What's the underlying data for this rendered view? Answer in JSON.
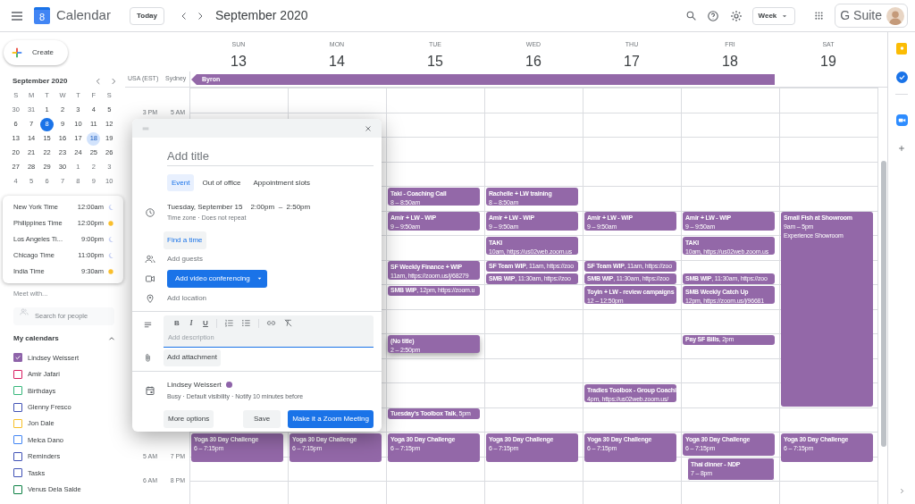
{
  "app": {
    "title": "Calendar",
    "logo_day": "8",
    "create_button": "Create"
  },
  "toolbar": {
    "today_button": "Today",
    "period": "September 2020",
    "view_dropdown": "Week",
    "suite_label": "G Suite"
  },
  "mini_calendar": {
    "title": "September 2020",
    "weekdays": [
      "S",
      "M",
      "T",
      "W",
      "T",
      "F",
      "S"
    ],
    "days": [
      {
        "d": "30",
        "kind": "outside"
      },
      {
        "d": "31",
        "kind": "outside"
      },
      {
        "d": "1",
        "kind": "normal"
      },
      {
        "d": "2",
        "kind": "normal"
      },
      {
        "d": "3",
        "kind": "normal"
      },
      {
        "d": "4",
        "kind": "normal"
      },
      {
        "d": "5",
        "kind": "normal"
      },
      {
        "d": "6",
        "kind": "normal"
      },
      {
        "d": "7",
        "kind": "normal"
      },
      {
        "d": "8",
        "kind": "today"
      },
      {
        "d": "9",
        "kind": "normal"
      },
      {
        "d": "10",
        "kind": "normal"
      },
      {
        "d": "11",
        "kind": "normal"
      },
      {
        "d": "12",
        "kind": "normal"
      },
      {
        "d": "13",
        "kind": "normal"
      },
      {
        "d": "14",
        "kind": "normal"
      },
      {
        "d": "15",
        "kind": "normal"
      },
      {
        "d": "16",
        "kind": "normal"
      },
      {
        "d": "17",
        "kind": "normal"
      },
      {
        "d": "18",
        "kind": "selected"
      },
      {
        "d": "19",
        "kind": "normal"
      },
      {
        "d": "20",
        "kind": "normal"
      },
      {
        "d": "21",
        "kind": "normal"
      },
      {
        "d": "22",
        "kind": "normal"
      },
      {
        "d": "23",
        "kind": "normal"
      },
      {
        "d": "24",
        "kind": "normal"
      },
      {
        "d": "25",
        "kind": "normal"
      },
      {
        "d": "26",
        "kind": "normal"
      },
      {
        "d": "27",
        "kind": "normal"
      },
      {
        "d": "28",
        "kind": "normal"
      },
      {
        "d": "29",
        "kind": "normal"
      },
      {
        "d": "30",
        "kind": "normal"
      },
      {
        "d": "1",
        "kind": "outside"
      },
      {
        "d": "2",
        "kind": "outside"
      },
      {
        "d": "3",
        "kind": "outside"
      },
      {
        "d": "4",
        "kind": "outside"
      },
      {
        "d": "5",
        "kind": "outside"
      },
      {
        "d": "6",
        "kind": "outside"
      },
      {
        "d": "7",
        "kind": "outside"
      },
      {
        "d": "8",
        "kind": "outside"
      },
      {
        "d": "9",
        "kind": "outside"
      },
      {
        "d": "10",
        "kind": "outside"
      }
    ]
  },
  "world_clock": [
    {
      "city": "New York Time",
      "time": "12:00am",
      "daytime": false
    },
    {
      "city": "Philippines Time",
      "time": "12:00pm",
      "daytime": true
    },
    {
      "city": "Los Angeles Ti...",
      "time": "9:00pm",
      "daytime": false
    },
    {
      "city": "Chicago Time",
      "time": "11:00pm",
      "daytime": false
    },
    {
      "city": "India Time",
      "time": "9:30am",
      "daytime": true
    }
  ],
  "meet_with": {
    "label": "Meet with...",
    "placeholder": "Search for people"
  },
  "my_calendars": {
    "title": "My calendars",
    "expanded": true,
    "items": [
      {
        "name": "Lindsey Weissert",
        "color": "#8e63a9",
        "checked": true
      },
      {
        "name": "Amir Jafari",
        "color": "#d81b60",
        "checked": false
      },
      {
        "name": "Birthdays",
        "color": "#33b679",
        "checked": false
      },
      {
        "name": "Glenny Fresco",
        "color": "#3f51b5",
        "checked": false
      },
      {
        "name": "Jon Dale",
        "color": "#f6bf26",
        "checked": false
      },
      {
        "name": "Melca Dano",
        "color": "#4285f4",
        "checked": false
      },
      {
        "name": "Reminders",
        "color": "#3f51b5",
        "checked": false
      },
      {
        "name": "Tasks",
        "color": "#3f51b5",
        "checked": false
      },
      {
        "name": "Venus Dela Salde",
        "color": "#0b8043",
        "checked": false
      }
    ]
  },
  "timezones": {
    "primary": "USA (EST)",
    "secondary": "Sydney"
  },
  "time_labels": [
    {
      "primary": "3 PM",
      "secondary": "5 AM"
    },
    {
      "primary": "5 AM",
      "secondary": "7 PM"
    },
    {
      "primary": "6 AM",
      "secondary": "8 PM"
    }
  ],
  "all_day_events": [
    {
      "title": "Byron",
      "continues_before": true
    }
  ],
  "days": [
    {
      "name": "SUN",
      "date": "13",
      "events": [
        {
          "kind": "block",
          "title": "Yoga 30 Day Challenge",
          "time": "6 – 7:15pm"
        }
      ]
    },
    {
      "name": "MON",
      "date": "14",
      "events": [
        {
          "kind": "block",
          "title": "Yoga 30 Day Challenge",
          "time": "6 – 7:15pm"
        }
      ]
    },
    {
      "name": "TUE",
      "date": "15",
      "events": [
        {
          "kind": "block",
          "title": "Taki - Coaching Call",
          "time": "8 – 8:50am"
        },
        {
          "kind": "block",
          "title": "Amir + LW - WIP",
          "time": "9 – 9:50am"
        },
        {
          "kind": "block",
          "title": "SF Weekly Finance + WIP",
          "time": "11am, https://zoom.us/j/68279"
        },
        {
          "kind": "inline",
          "text": "**SMB WIP**, 12pm, https://zoom.u"
        },
        {
          "kind": "draft",
          "title": "(No title)",
          "time": "2 – 2:50pm"
        },
        {
          "kind": "inline",
          "text": "**Tuesday's Toolbox Talk**, 5pm"
        },
        {
          "kind": "block",
          "title": "Yoga 30 Day Challenge",
          "time": "6 – 7:15pm"
        }
      ]
    },
    {
      "name": "WED",
      "date": "16",
      "events": [
        {
          "kind": "block",
          "title": "Rachelle + LW training",
          "time": "8 – 8:50am"
        },
        {
          "kind": "block",
          "title": "Amir + LW - WIP",
          "time": "9 – 9:50am"
        },
        {
          "kind": "block",
          "title": "TAKI",
          "time": "10am, https://us02web.zoom.us"
        },
        {
          "kind": "inline",
          "text": "**SF Team WIP**, 11am, https://zoo"
        },
        {
          "kind": "inline",
          "text": "**SMB WIP**, 11:30am, https://zoo"
        },
        {
          "kind": "block",
          "title": "Yoga 30 Day Challenge",
          "time": "6 – 7:15pm"
        }
      ]
    },
    {
      "name": "THU",
      "date": "17",
      "events": [
        {
          "kind": "block",
          "title": "Amir + LW - WIP",
          "time": "9 – 9:50am"
        },
        {
          "kind": "inline",
          "text": "**SF Team WIP**, 11am, https://zoo"
        },
        {
          "kind": "inline",
          "text": "**SMB WIP**, 11:30am, https://zoo"
        },
        {
          "kind": "block",
          "title": "Toyin + LW - review campaigns",
          "time": "12 – 12:50pm"
        },
        {
          "kind": "block",
          "title": "Tradies Toolbox - Group Coachi",
          "time": "4pm, https://us02web.zoom.us/"
        },
        {
          "kind": "block",
          "title": "Yoga 30 Day Challenge",
          "time": "6 – 7:15pm"
        }
      ]
    },
    {
      "name": "FRI",
      "date": "18",
      "events": [
        {
          "kind": "block",
          "title": "Amir + LW - WIP",
          "time": "9 – 9:50am"
        },
        {
          "kind": "block",
          "title": "TAKI",
          "time": "10am, https://us02web.zoom.us"
        },
        {
          "kind": "inline",
          "text": "**SMB WIP**, 11:30am, https://zoo"
        },
        {
          "kind": "block",
          "title": "SMB Weekly Catch Up",
          "time": "12pm, https://zoom.us/j/96681"
        },
        {
          "kind": "inline",
          "text": "**Pay SF Bills**, 2pm"
        },
        {
          "kind": "block",
          "title": "Yoga 30 Day Challenge",
          "time": "6 – 7:15pm"
        },
        {
          "kind": "overlap",
          "title": "Thai dinner - NDP",
          "time": "7 – 8pm"
        }
      ]
    },
    {
      "name": "SAT",
      "date": "19",
      "events": [
        {
          "kind": "block",
          "title": "Small Fish at Showroom",
          "time": "9am – 5pm",
          "location": "Experience Showroom"
        },
        {
          "kind": "block",
          "title": "Yoga 30 Day Challenge",
          "time": "6 – 7:15pm"
        }
      ]
    }
  ],
  "event_dialog": {
    "title_placeholder": "Add title",
    "tabs": [
      {
        "label": "Event",
        "selected": true
      },
      {
        "label": "Out of office",
        "selected": false
      },
      {
        "label": "Appointment slots",
        "selected": false
      }
    ],
    "date": "Tuesday, September 15",
    "time_range": "2:00pm  –  2:50pm",
    "repeat_info": "Time zone · Does not repeat",
    "find_time_button": "Find a time",
    "guests_placeholder": "Add guests",
    "video_button": "Add video conferencing",
    "location_placeholder": "Add location",
    "format_buttons": [
      "B",
      "I",
      "U"
    ],
    "description_placeholder": "Add description",
    "attachment_button": "Add attachment",
    "calendar": {
      "name": "Lindsey Weissert",
      "color": "#8e63a9"
    },
    "calendar_details": "Busy · Default visibility · Notify 10 minutes before",
    "buttons": [
      {
        "label": "More options",
        "kind": "secondary"
      },
      {
        "label": "Save",
        "kind": "secondary"
      },
      {
        "label": "Make it a Zoom Meeting",
        "kind": "primary"
      }
    ]
  }
}
